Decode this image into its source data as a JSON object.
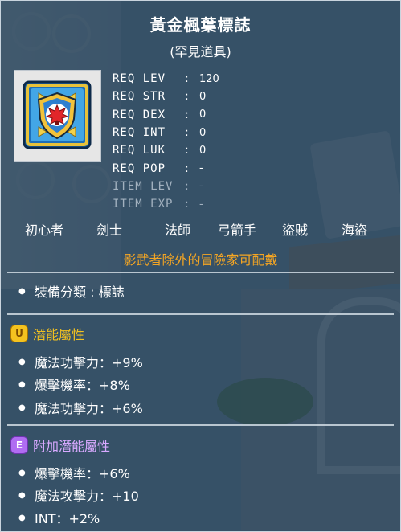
{
  "item": {
    "name": "黃金楓葉標誌",
    "rarity": "(罕見道具)",
    "icon": "golden-maple-emblem-icon"
  },
  "requirements": [
    {
      "label": "REQ LEV",
      "value": "120",
      "dim": false
    },
    {
      "label": "REQ STR",
      "value": "0",
      "dim": false
    },
    {
      "label": "REQ DEX",
      "value": "0",
      "dim": false
    },
    {
      "label": "REQ INT",
      "value": "0",
      "dim": false
    },
    {
      "label": "REQ LUK",
      "value": "0",
      "dim": false
    },
    {
      "label": "REQ POP",
      "value": "-",
      "dim": false
    },
    {
      "label": "ITEM LEV",
      "value": "-",
      "dim": true
    },
    {
      "label": "ITEM EXP",
      "value": "-",
      "dim": true
    }
  ],
  "jobs": [
    "初心者",
    "劍士",
    "法師",
    "弓箭手",
    "盜賊",
    "海盜"
  ],
  "restriction": "影武者除外的冒險家可配戴",
  "category": "裝備分類 : 標誌",
  "potential": {
    "badge": "U",
    "label": "潛能屬性",
    "lines": [
      "魔法功擊力：+9%",
      "爆擊機率：+8%",
      "魔法功擊力：+6%"
    ]
  },
  "additional": {
    "badge": "E",
    "label": "附加潛能屬性",
    "lines": [
      "爆擊機率：+6%",
      "魔法攻擊力：+10",
      "INT：+2%"
    ]
  },
  "colors": {
    "panel": "#1c3448",
    "restriction": "#f5a623",
    "potential": "#f4c21f",
    "additional": "#b06cf2"
  }
}
